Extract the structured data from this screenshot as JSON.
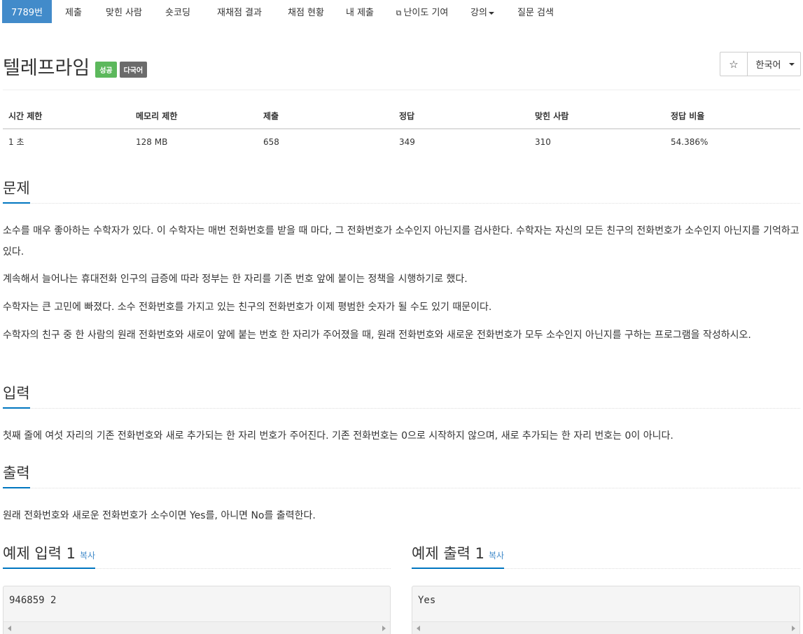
{
  "nav": {
    "items": [
      {
        "label": "7789번"
      },
      {
        "label": "제출"
      },
      {
        "label": "맞힌 사람"
      },
      {
        "label": "숏코딩"
      },
      {
        "label": "재채점 결과"
      },
      {
        "label": "채점 현황"
      },
      {
        "label": "내 제출"
      },
      {
        "label": "난이도 기여"
      },
      {
        "label": "강의"
      },
      {
        "label": "질문 검색"
      }
    ],
    "active_color": "#428bca"
  },
  "problem": {
    "title": "텔레프라임",
    "badge_success": "성공",
    "badge_lang": "다국어",
    "star": "☆",
    "language": "한국어"
  },
  "info_table": {
    "headers": [
      "시간 제한",
      "메모리 제한",
      "제출",
      "정답",
      "맞힌 사람",
      "정답 비율"
    ],
    "row": [
      "1 초",
      "128 MB",
      "658",
      "349",
      "310",
      "54.386%"
    ]
  },
  "sections": {
    "problem_title": "문제",
    "problem_paragraphs": [
      "소수를 매우 좋아하는 수학자가 있다. 이 수학자는 매번 전화번호를 받을 때 마다, 그 전화번호가 소수인지 아닌지를 검사한다. 수학자는 자신의 모든 친구의 전화번호가 소수인지 아닌지를 기억하고 있다.",
      "계속해서 늘어나는 휴대전화 인구의 급증에 따라 정부는 한 자리를 기존 번호 앞에 붙이는 정책을 시행하기로 했다.",
      "수학자는 큰 고민에 빠졌다. 소수 전화번호를 가지고 있는 친구의 전화번호가 이제 평범한 숫자가 될 수도 있기 때문이다.",
      "수학자의 친구 중 한 사람의 원래 전화번호와 새로이 앞에 붙는 번호 한 자리가 주어졌을 때, 원래 전화번호와 새로운 전화번호가 모두 소수인지 아닌지를 구하는 프로그램을 작성하시오."
    ],
    "input_title": "입력",
    "input_text": "첫째 줄에 여섯 자리의 기존 전화번호와 새로 추가되는 한 자리 번호가 주어진다. 기존 전화번호는 0으로 시작하지 않으며, 새로 추가되는 한 자리 번호는 0이 아니다.",
    "output_title": "출력",
    "output_text": "원래 전화번호와 새로운 전화번호가 소수이면 Yes를, 아니면 No를 출력한다."
  },
  "samples": {
    "input_title": "예제 입력 1",
    "output_title": "예제 출력 1",
    "copy_label": "복사",
    "input_value": "946859 2",
    "output_value": "Yes"
  }
}
